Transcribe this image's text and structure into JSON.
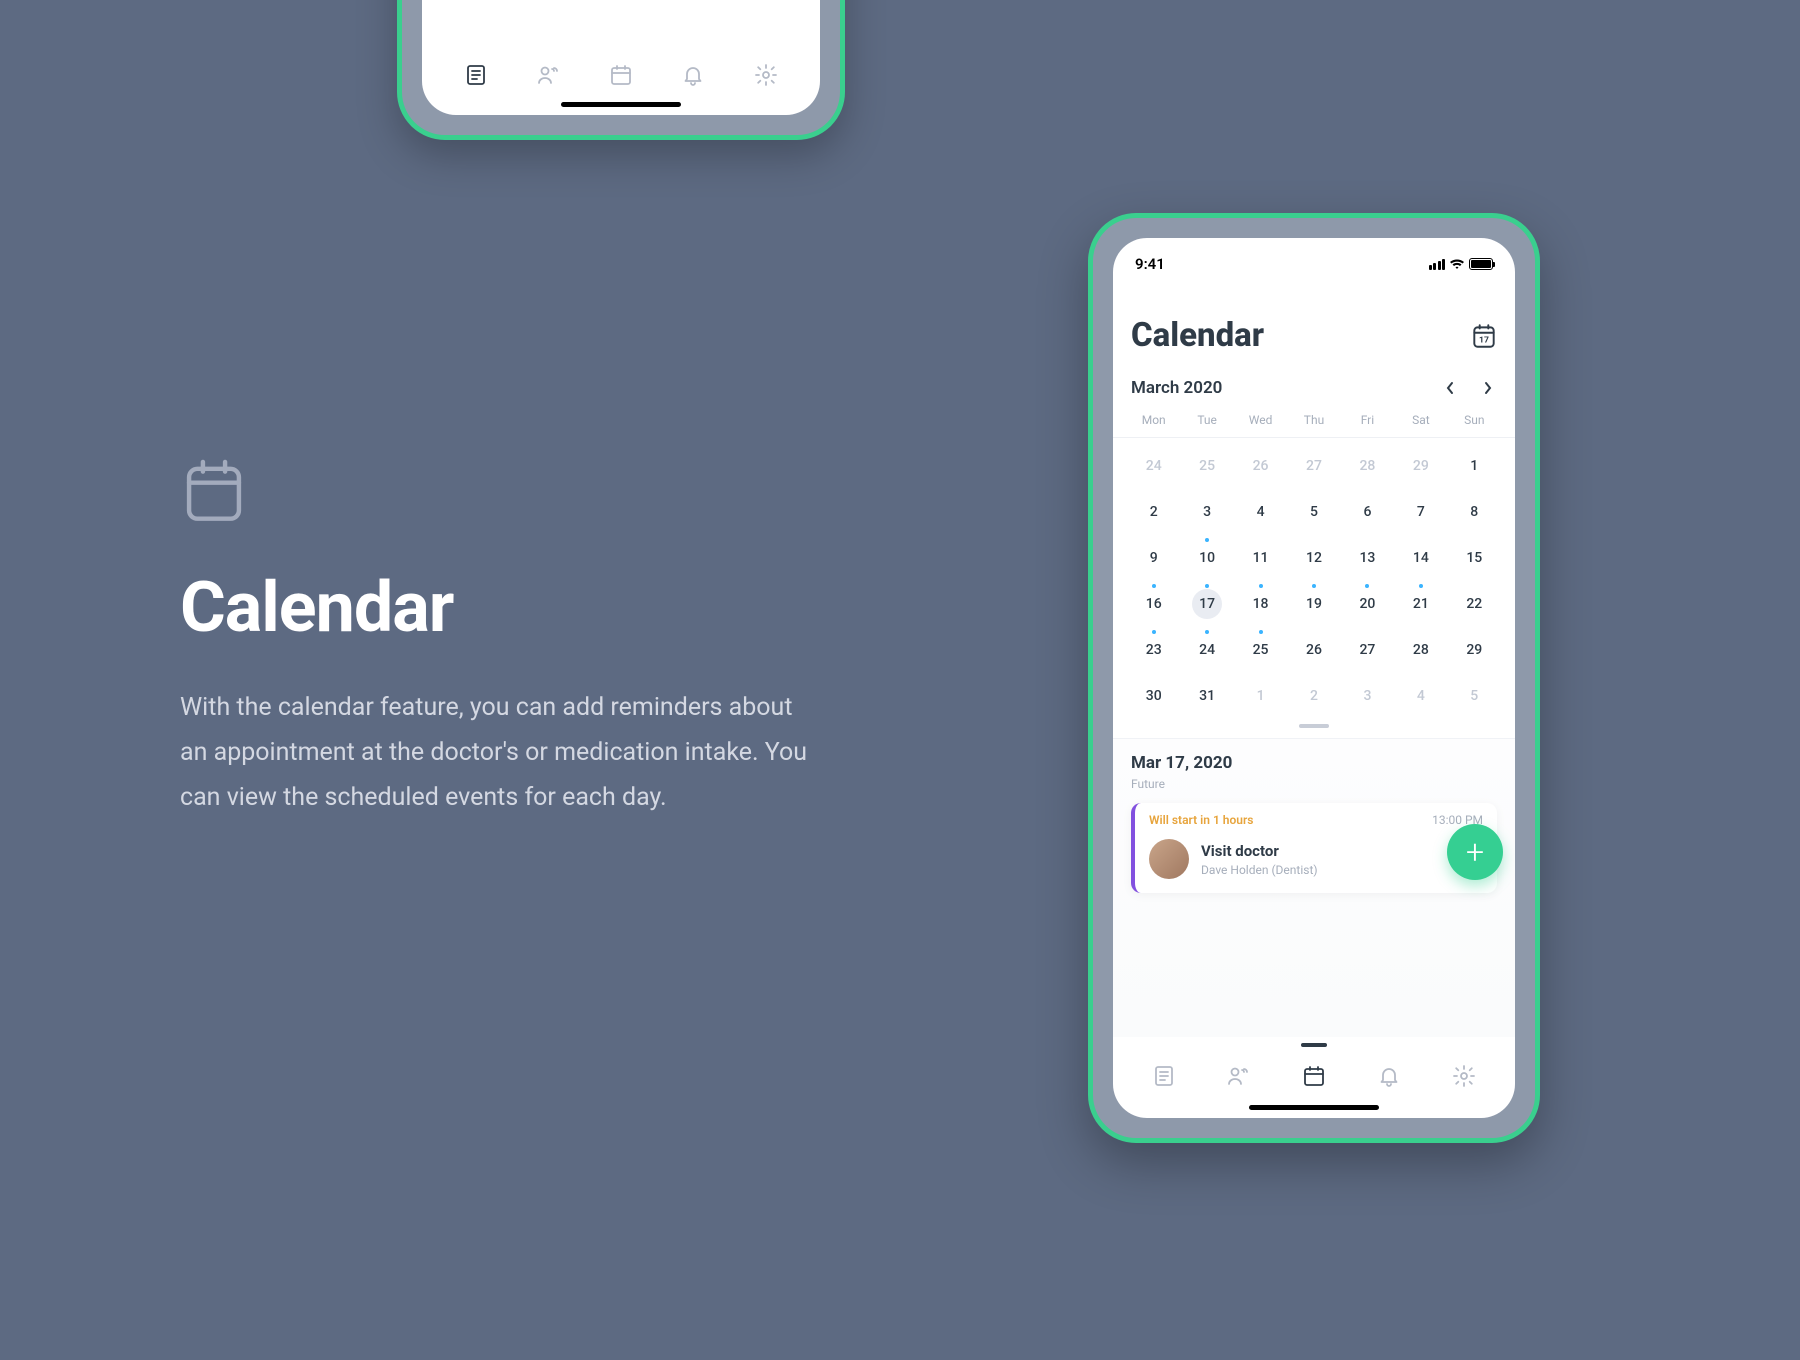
{
  "info": {
    "title": "Calendar",
    "description": "With the calendar feature, you can add reminders about an appointment at the doctor's or medication intake. You can view the scheduled events for each day."
  },
  "phone": {
    "status_time": "9:41",
    "header": {
      "title": "Calendar",
      "badge_day": "17"
    },
    "month_label": "March 2020",
    "weekdays": [
      "Mon",
      "Tue",
      "Wed",
      "Thu",
      "Fri",
      "Sat",
      "Sun"
    ],
    "days": [
      {
        "n": "24",
        "out": true
      },
      {
        "n": "25",
        "out": true
      },
      {
        "n": "26",
        "out": true
      },
      {
        "n": "27",
        "out": true
      },
      {
        "n": "28",
        "out": true
      },
      {
        "n": "29",
        "out": true
      },
      {
        "n": "1"
      },
      {
        "n": "2"
      },
      {
        "n": "3"
      },
      {
        "n": "4"
      },
      {
        "n": "5"
      },
      {
        "n": "6"
      },
      {
        "n": "7"
      },
      {
        "n": "8"
      },
      {
        "n": "9"
      },
      {
        "n": "10",
        "dot": true
      },
      {
        "n": "11"
      },
      {
        "n": "12"
      },
      {
        "n": "13"
      },
      {
        "n": "14"
      },
      {
        "n": "15"
      },
      {
        "n": "16",
        "dot": true
      },
      {
        "n": "17",
        "dot": true,
        "sel": true
      },
      {
        "n": "18",
        "dot": true
      },
      {
        "n": "19",
        "dot": true
      },
      {
        "n": "20",
        "dot": true
      },
      {
        "n": "21",
        "dot": true
      },
      {
        "n": "22"
      },
      {
        "n": "23",
        "dot": true
      },
      {
        "n": "24",
        "dot": true
      },
      {
        "n": "25",
        "dot": true
      },
      {
        "n": "26"
      },
      {
        "n": "27"
      },
      {
        "n": "28"
      },
      {
        "n": "29"
      },
      {
        "n": "30"
      },
      {
        "n": "31"
      },
      {
        "n": "1",
        "out": true
      },
      {
        "n": "2",
        "out": true
      },
      {
        "n": "3",
        "out": true
      },
      {
        "n": "4",
        "out": true
      },
      {
        "n": "5",
        "out": true
      }
    ],
    "sheet": {
      "date": "Mar 17, 2020",
      "sub": "Future",
      "event": {
        "warn": "Will start in 1 hours",
        "time": "13:00 PM",
        "title": "Visit doctor",
        "subtitle": "Dave Holden (Dentist)"
      }
    },
    "tabs": [
      "notes",
      "people",
      "calendar",
      "bell",
      "settings"
    ],
    "active_tab": 2
  },
  "top_phone": {
    "active_tab": 0
  }
}
